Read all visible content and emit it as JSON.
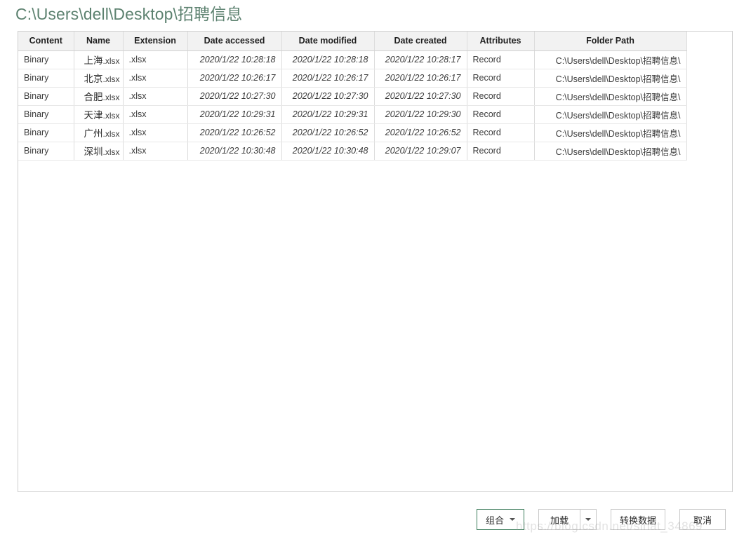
{
  "title": "C:\\Users\\dell\\Desktop\\招聘信息",
  "table": {
    "columns": [
      {
        "key": "content",
        "label": "Content"
      },
      {
        "key": "name",
        "label": "Name"
      },
      {
        "key": "extension",
        "label": "Extension"
      },
      {
        "key": "accessed",
        "label": "Date accessed"
      },
      {
        "key": "modified",
        "label": "Date modified"
      },
      {
        "key": "created",
        "label": "Date created"
      },
      {
        "key": "attributes",
        "label": "Attributes"
      },
      {
        "key": "folder",
        "label": "Folder Path"
      }
    ],
    "rows": [
      {
        "content": "Binary",
        "name_base": "上海",
        "name_ext": ".xlsx",
        "extension": ".xlsx",
        "accessed": "2020/1/22 10:28:18",
        "modified": "2020/1/22 10:28:18",
        "created": "2020/1/22 10:28:17",
        "attributes": "Record",
        "folder": "C:\\Users\\dell\\Desktop\\招聘信息\\"
      },
      {
        "content": "Binary",
        "name_base": "北京",
        "name_ext": ".xlsx",
        "extension": ".xlsx",
        "accessed": "2020/1/22 10:26:17",
        "modified": "2020/1/22 10:26:17",
        "created": "2020/1/22 10:26:17",
        "attributes": "Record",
        "folder": "C:\\Users\\dell\\Desktop\\招聘信息\\"
      },
      {
        "content": "Binary",
        "name_base": "合肥",
        "name_ext": ".xlsx",
        "extension": ".xlsx",
        "accessed": "2020/1/22 10:27:30",
        "modified": "2020/1/22 10:27:30",
        "created": "2020/1/22 10:27:30",
        "attributes": "Record",
        "folder": "C:\\Users\\dell\\Desktop\\招聘信息\\"
      },
      {
        "content": "Binary",
        "name_base": "天津",
        "name_ext": ".xlsx",
        "extension": ".xlsx",
        "accessed": "2020/1/22 10:29:31",
        "modified": "2020/1/22 10:29:31",
        "created": "2020/1/22 10:29:30",
        "attributes": "Record",
        "folder": "C:\\Users\\dell\\Desktop\\招聘信息\\"
      },
      {
        "content": "Binary",
        "name_base": "广州",
        "name_ext": ".xlsx",
        "extension": ".xlsx",
        "accessed": "2020/1/22 10:26:52",
        "modified": "2020/1/22 10:26:52",
        "created": "2020/1/22 10:26:52",
        "attributes": "Record",
        "folder": "C:\\Users\\dell\\Desktop\\招聘信息\\"
      },
      {
        "content": "Binary",
        "name_base": "深圳",
        "name_ext": ".xlsx",
        "extension": ".xlsx",
        "accessed": "2020/1/22 10:30:48",
        "modified": "2020/1/22 10:30:48",
        "created": "2020/1/22 10:29:07",
        "attributes": "Record",
        "folder": "C:\\Users\\dell\\Desktop\\招聘信息\\"
      }
    ]
  },
  "footer": {
    "combine_label": "组合",
    "load_label": "加载",
    "transform_label": "转换数据",
    "cancel_label": "取消",
    "combine_caret_icon": "chevron-down-icon",
    "load_caret_icon": "chevron-down-icon"
  },
  "watermark": "https://blog.csdn.net/sinat_34869",
  "colors": {
    "title": "#5d8270",
    "primary_button_border": "#3d7d5b",
    "header_bg": "#f2f2f2",
    "grid_line": "#dcdcdc",
    "panel_border": "#cfcfcf"
  }
}
